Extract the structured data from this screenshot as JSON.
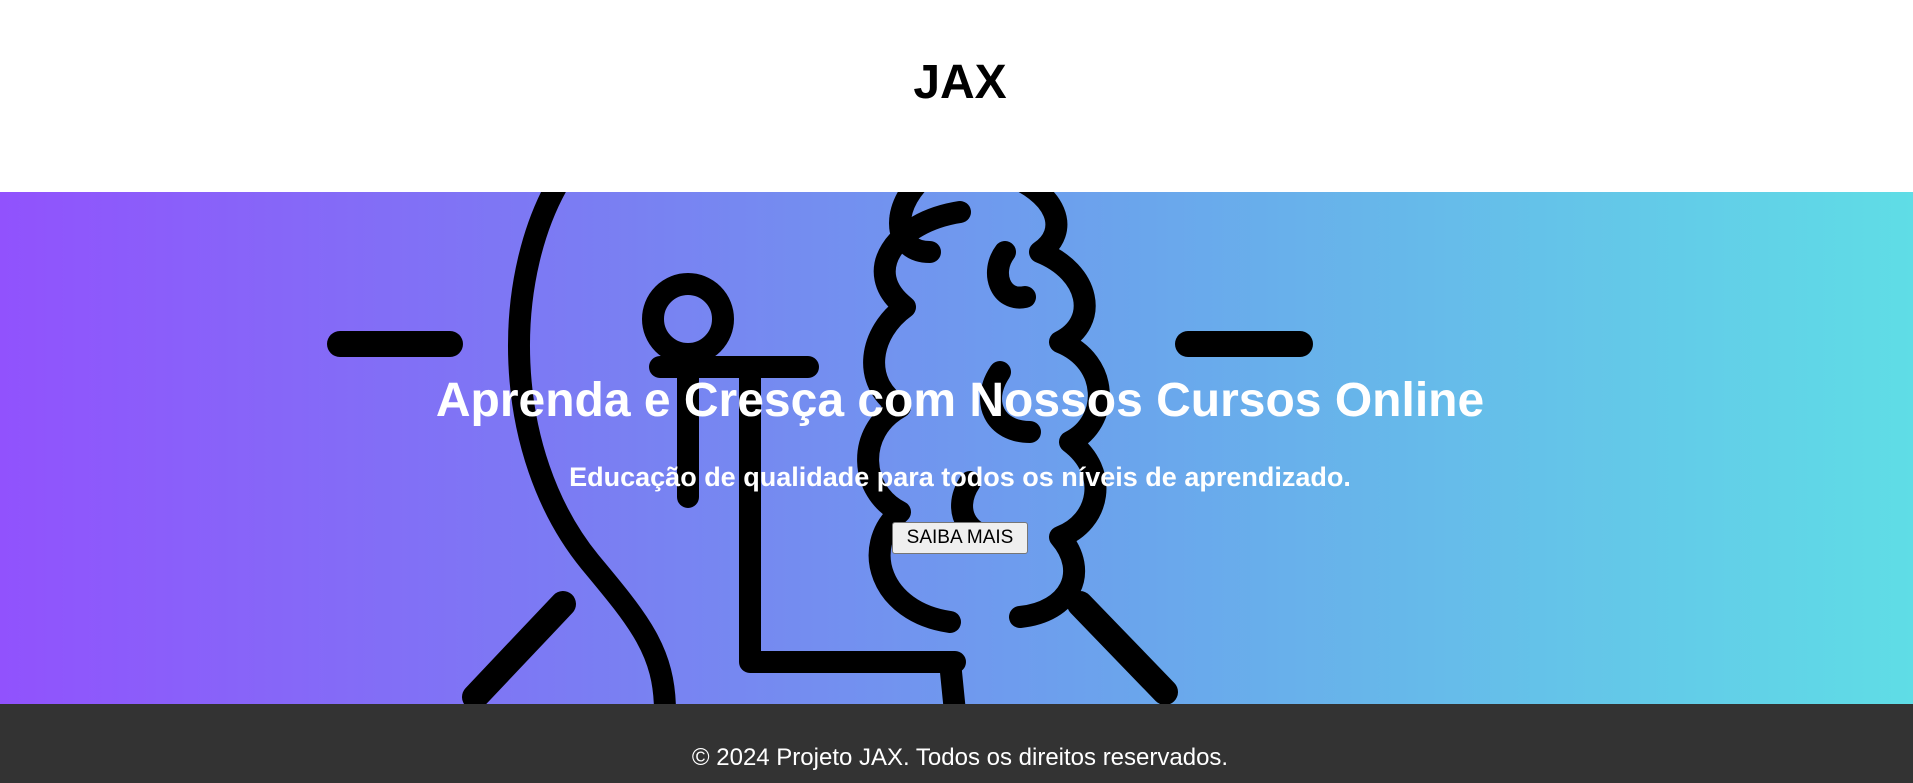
{
  "header": {
    "logo": "JAX"
  },
  "hero": {
    "title": "Aprenda e Cresça com Nossos Cursos Online",
    "subtitle": "Educação de qualidade para todos os níveis de aprendizado.",
    "cta_label": "SAIBA MAIS",
    "gradient_start": "#9152fd",
    "gradient_end": "#5fdde6",
    "illustration_icon": "lightbulb-brain-icon"
  },
  "footer": {
    "copyright": "© 2024 Projeto JAX. Todos os direitos reservados.",
    "background": "#333333"
  }
}
